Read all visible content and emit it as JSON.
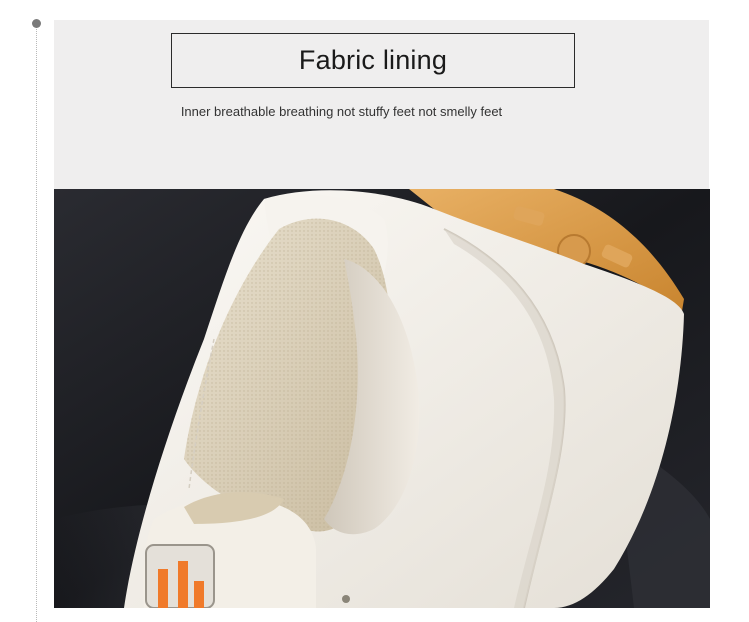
{
  "heading": {
    "title": "Fabric lining",
    "subtitle": "Inner breathable breathing not stuffy feet not smelly feet"
  },
  "photo": {
    "subject": "shoe-lining-photo",
    "colors": {
      "background_leather": "#1c1d22",
      "shoe_white": "#f2efe9",
      "lining_beige": "#d9cdb6",
      "sole_gum": "#d99a48",
      "logo_orange": "#f07a2a"
    }
  }
}
